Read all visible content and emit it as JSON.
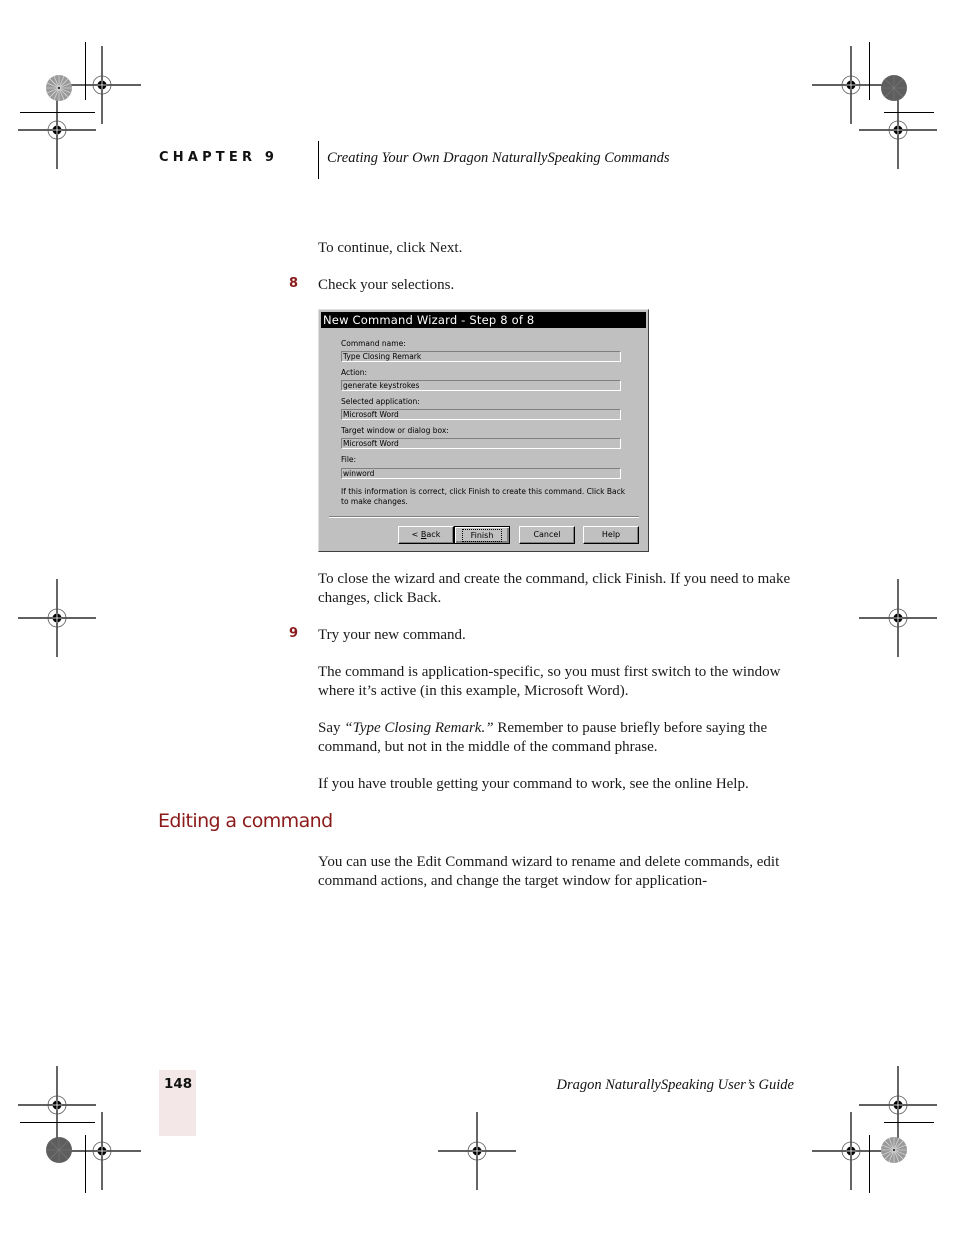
{
  "header": {
    "chapter_label": "CHAPTER 9",
    "chapter_title": "Creating Your Own Dragon NaturallySpeaking Commands"
  },
  "content": {
    "intro_text": "To continue, click Next.",
    "step8": {
      "number": "8",
      "text": "Check your selections."
    },
    "after_dialog_text": "To close the wizard and create the command, click Finish. If you need to make changes, click Back.",
    "step9": {
      "number": "9",
      "text": "Try your new command."
    },
    "paragraph_app_specific": "The command is application-specific, so you must first switch to the window where it’s active (in this example, Microsoft Word).",
    "say_prefix": "Say ",
    "say_command": "“Type Closing Remark.”",
    "say_suffix": " Remember to pause briefly before saying the command, but not in the middle of the command phrase.",
    "trouble_text": "If you have trouble getting your command to work, see the online Help.",
    "section_heading": "Editing a command",
    "section_text": "You can use the Edit Command wizard to rename and delete commands, edit command actions, and change the target window for application-"
  },
  "dialog": {
    "title": "New Command Wizard - Step 8 of 8",
    "fields": [
      {
        "label": "Command name:",
        "value": "Type Closing Remark"
      },
      {
        "label": "Action:",
        "value": "generate keystrokes"
      },
      {
        "label": "Selected application:",
        "value": "Microsoft Word"
      },
      {
        "label": "Target window or dialog box:",
        "value": "Microsoft Word"
      },
      {
        "label": "File:",
        "value": "winword"
      }
    ],
    "note": "If this information is correct, click Finish to create this command.  Click Back to make changes.",
    "buttons": {
      "back_prefix": "< ",
      "back_mnemonic": "B",
      "back_rest": "ack",
      "finish": "Finish",
      "cancel": "Cancel",
      "help": "Help"
    }
  },
  "footer": {
    "page_number": "148",
    "book_title": "Dragon NaturallySpeaking User’s Guide"
  },
  "colors": {
    "accent": "#8b1a1a",
    "page_tab": "#f3e7e7",
    "dialog_bg": "#c0c0c0",
    "titlebar": "#000000"
  }
}
